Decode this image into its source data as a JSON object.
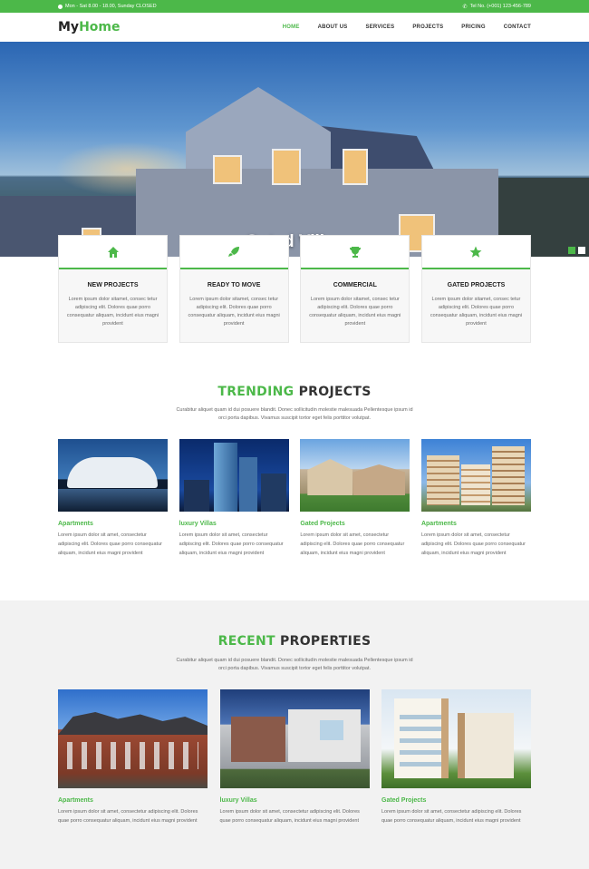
{
  "topbar": {
    "hours": "Mon - Sat 8.00 - 18.00, Sunday CLOSED",
    "phone": "Tel No. (+001) 123-456-789"
  },
  "header": {
    "logo_part1": "My",
    "logo_part2": "Home",
    "nav": [
      "HOME",
      "ABOUT US",
      "SERVICES",
      "PROJECTS",
      "PRICING",
      "CONTACT"
    ]
  },
  "hero": {
    "title": "Gated Villas"
  },
  "features": [
    {
      "icon": "home-icon",
      "title": "NEW PROJECTS",
      "text": "Lorem ipsum dolor sitamet, consec tetur adipiscing elit. Dolores quae porro consequatur aliquam, incidunt eius magni provident"
    },
    {
      "icon": "rocket-icon",
      "title": "READY TO MOVE",
      "text": "Lorem ipsum dolor sitamet, consec tetur adipiscing elit. Dolores quae porro consequatur aliquam, incidunt eius magni provident"
    },
    {
      "icon": "trophy-icon",
      "title": "COMMERCIAL",
      "text": "Lorem ipsum dolor sitamet, consec tetur adipiscing elit. Dolores quae porro consequatur aliquam, incidunt eius magni provident"
    },
    {
      "icon": "star-icon",
      "title": "GATED PROJECTS",
      "text": "Lorem ipsum dolor sitamet, consec tetur adipiscing elit. Dolores quae porro consequatur aliquam, incidunt eius magni provident"
    }
  ],
  "trending": {
    "title_green": "TRENDING",
    "title_dark": " PROJECTS",
    "subtitle": "Curabitur aliquet quam id dui posuere blandit. Donec sollicitudin molestie malesuada Pellentesque ipsum id orci porta dapibus. Vivamus suscipit tortor eget felis porttitor volutpat.",
    "items": [
      {
        "name": "Apartments",
        "text": "Lorem ipsum dolor sit amet, consectetur adipiscing elit. Dolores quae porro consequatur aliquam, incidunt eius magni provident"
      },
      {
        "name": "luxury Villas",
        "text": "Lorem ipsum dolor sit amet, consectetur adipiscing elit. Dolores quae porro consequatur aliquam, incidunt eius magni provident"
      },
      {
        "name": "Gated Projects",
        "text": "Lorem ipsum dolor sit amet, consectetur adipiscing elit. Dolores quae porro consequatur aliquam, incidunt eius magni provident"
      },
      {
        "name": "Apartments",
        "text": "Lorem ipsum dolor sit amet, consectetur adipiscing elit. Dolores quae porro consequatur aliquam, incidunt eius magni provident"
      }
    ]
  },
  "recent": {
    "title_green": "RECENT",
    "title_dark": " PROPERTIES",
    "subtitle": "Curabitur aliquet quam id dui posuere blandit. Donec sollicitudin molestie malesuada Pellentesque ipsum id orci porta dapibus. Vivamus suscipit tortor eget felis porttitor volutpat.",
    "items": [
      {
        "name": "Apartments",
        "text": "Lorem ipsum dolor sit amet, consectetur adipiscing elit. Dolores quae porro consequatur aliquam, incidunt eius magni provident"
      },
      {
        "name": "luxury Villas",
        "text": "Lorem ipsum dolor sit amet, consectetur adipiscing elit. Dolores quae porro consequatur aliquam, incidunt eius magni provident"
      },
      {
        "name": "Gated Projects",
        "text": "Lorem ipsum dolor sit amet, consectetur adipiscing elit. Dolores quae porro consequatur aliquam, incidunt eius magni provident"
      }
    ]
  },
  "colors": {
    "accent": "#4cb849",
    "dark": "#333333"
  }
}
